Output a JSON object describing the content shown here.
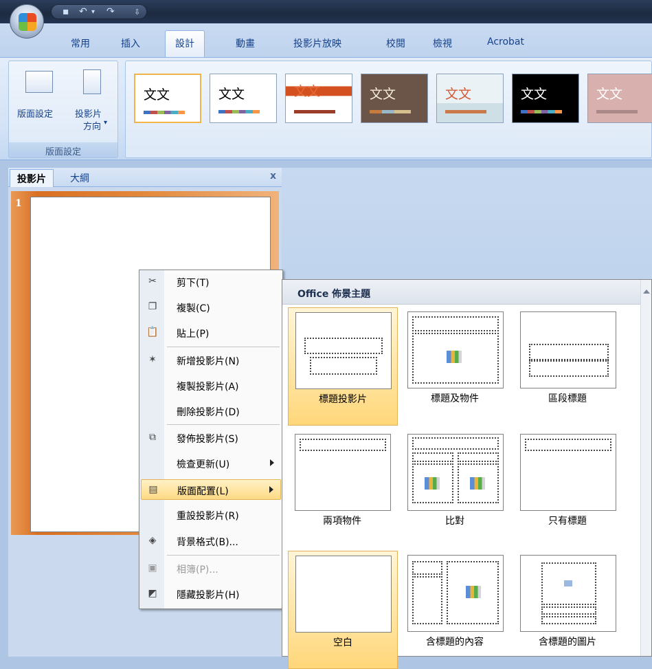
{
  "ribbon_tabs": [
    "常用",
    "插入",
    "設計",
    "動畫",
    "投影片放映",
    "校閱",
    "檢視",
    "Acrobat"
  ],
  "active_tab": "設計",
  "page_setup": {
    "btn1": "版面設定",
    "btn2_line1": "投影片",
    "btn2_line2": "方向",
    "group_label": "版面設定"
  },
  "theme_label": "文文",
  "pane": {
    "tab_slides": "投影片",
    "tab_outline": "大綱",
    "close": "x",
    "slide_number": "1"
  },
  "context_menu": [
    {
      "label": "剪下(T)",
      "icon": "scissors-icon"
    },
    {
      "label": "複製(C)",
      "icon": "copy-icon"
    },
    {
      "label": "貼上(P)",
      "icon": "paste-icon"
    },
    {
      "label": "新增投影片(N)",
      "icon": "new-slide-icon"
    },
    {
      "label": "複製投影片(A)",
      "icon": ""
    },
    {
      "label": "刪除投影片(D)",
      "icon": ""
    },
    {
      "label": "發佈投影片(S)",
      "icon": "publish-slides-icon"
    },
    {
      "label": "檢查更新(U)",
      "icon": ""
    },
    {
      "label": "版面配置(L)",
      "icon": "layout-icon"
    },
    {
      "label": "重設投影片(R)",
      "icon": ""
    },
    {
      "label": "背景格式(B)...",
      "icon": "background-format-icon"
    },
    {
      "label": "相簿(P)...",
      "icon": "photo-album-icon"
    },
    {
      "label": "隱藏投影片(H)",
      "icon": "hide-slide-icon"
    }
  ],
  "gallery": {
    "title": "Office 佈景主題",
    "layouts": [
      "標題投影片",
      "標題及物件",
      "區段標題",
      "兩項物件",
      "比對",
      "只有標題",
      "空白",
      "含標題的內容",
      "含標題的圖片"
    ],
    "selected": [
      "標題投影片",
      "空白"
    ]
  }
}
